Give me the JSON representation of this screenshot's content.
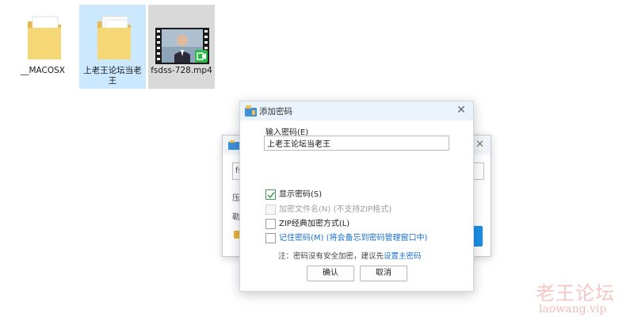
{
  "desktop": {
    "files": [
      {
        "label": "__MACOSX",
        "type": "folder"
      },
      {
        "label": "上老王论坛当老王",
        "type": "folder"
      },
      {
        "label": "fsdss-728.mp4",
        "type": "video"
      }
    ]
  },
  "background_dialog": {
    "field_prefix": "fs",
    "row1": "压",
    "row2": "勒"
  },
  "dialog": {
    "title": "添加密码",
    "icon": "archive-folder-icon",
    "password_label": "输入密码(E)",
    "password_value": "上老王论坛当老王",
    "options": {
      "show_password": {
        "label": "显示密码(S)",
        "checked": true
      },
      "encrypt_filename": {
        "label": "加密文件名(N) (不支持ZIP格式)",
        "checked": false,
        "disabled": true
      },
      "zip_classic": {
        "label": "ZIP经典加密方式(L)",
        "checked": false
      },
      "remember_password": {
        "label": "记住密码(M)",
        "label_extra": "(将会备忘到密码管理窗口中)",
        "checked": false
      }
    },
    "note_prefix": "注：密码没有安全加密，建议先",
    "note_link": "设置主密码",
    "ok_label": "确认",
    "cancel_label": "取消"
  },
  "watermark": {
    "cn": "老王论坛",
    "en": "laowang.vip"
  },
  "colors": {
    "accent": "#1a6fd0",
    "check": "#4a9a5a",
    "titlebar": "#eaf3fb"
  }
}
